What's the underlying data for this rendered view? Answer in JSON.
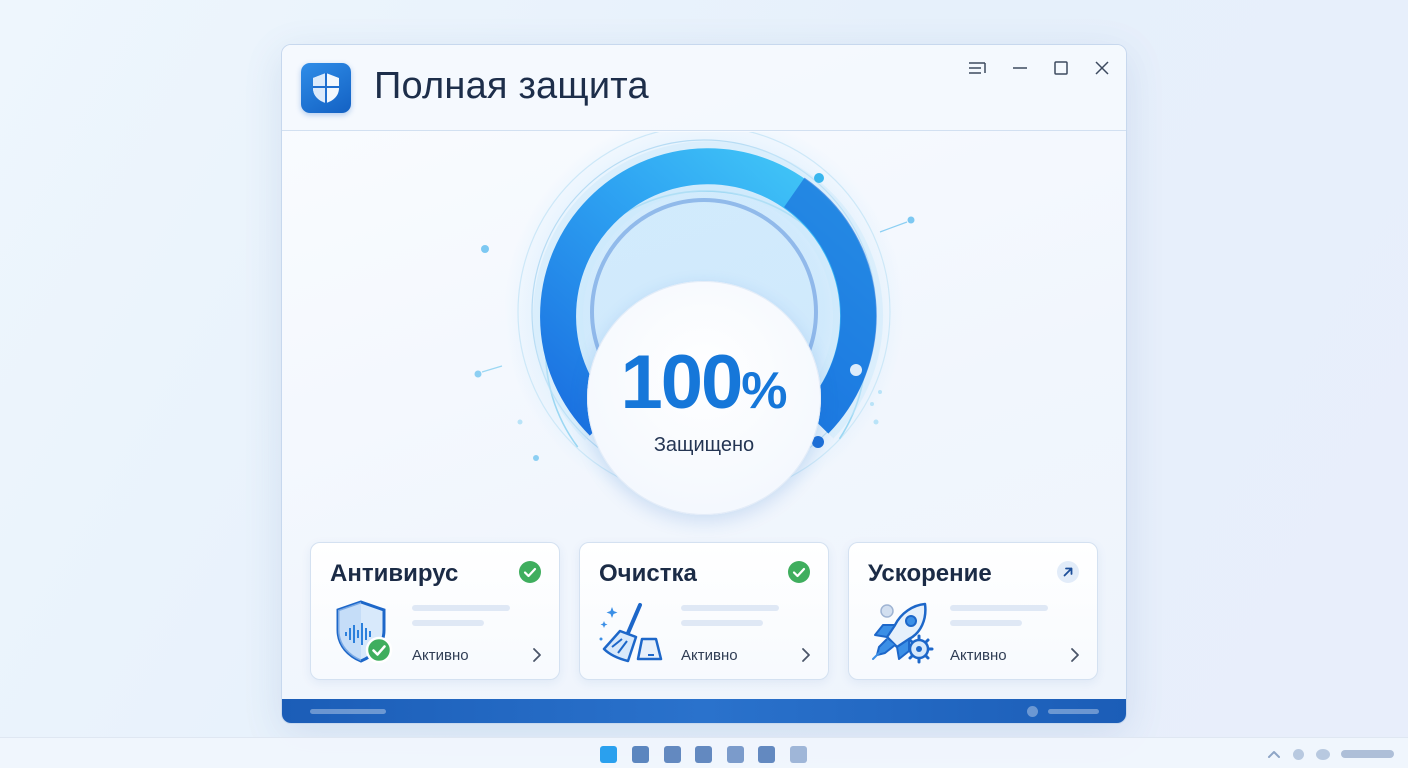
{
  "window": {
    "title": "Полная защита",
    "controls": [
      "menu-icon",
      "minimize-icon",
      "maximize-icon",
      "close-icon"
    ]
  },
  "gauge": {
    "value": "100",
    "unit": "%",
    "status": "Защищено",
    "progress": 1.0,
    "colors": {
      "arc_light": "#3ec5f7",
      "arc_dark": "#1565d4",
      "ring": "#5fc2ea"
    }
  },
  "cards": [
    {
      "title": "Антивирус",
      "status": "Активно",
      "badge": "check-icon",
      "icon": "shield-icon"
    },
    {
      "title": "Очистка",
      "status": "Активно",
      "badge": "check-icon",
      "icon": "broom-icon"
    },
    {
      "title": "Ускорение",
      "status": "",
      "badge": "arrow-up-right-icon",
      "icon": "rocket-icon"
    }
  ],
  "card3_status": "Активно",
  "colors": {
    "accent": "#1677d9",
    "success": "#3fae5e",
    "footer": "#1f63bd"
  }
}
